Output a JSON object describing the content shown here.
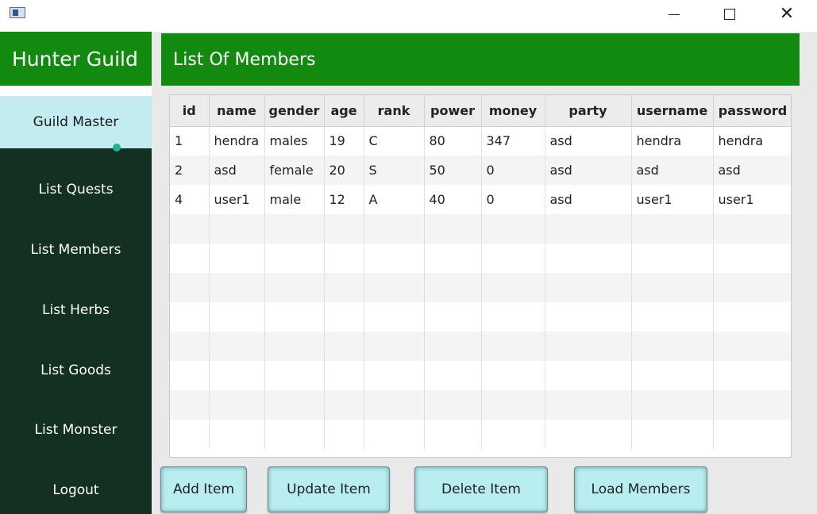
{
  "window": {
    "icons": {
      "minimize": "minimize-icon",
      "maximize": "maximize-icon",
      "close": "close-icon",
      "app": "app-icon"
    }
  },
  "sidebar": {
    "title": "Hunter Guild",
    "items": [
      {
        "label": "Guild Master",
        "active": true
      },
      {
        "label": "List Quests"
      },
      {
        "label": "List Members"
      },
      {
        "label": "List Herbs"
      },
      {
        "label": "List Goods"
      },
      {
        "label": "List Monster"
      },
      {
        "label": "Logout"
      }
    ]
  },
  "main": {
    "title": "List Of Members"
  },
  "table": {
    "columns": [
      "id",
      "name",
      "gender",
      "age",
      "rank",
      "power",
      "money",
      "party",
      "username",
      "password"
    ],
    "rows": [
      [
        "1",
        "hendra",
        "males",
        "19",
        "C",
        "80",
        "347",
        "asd",
        "hendra",
        "hendra"
      ],
      [
        "2",
        "asd",
        "female",
        "20",
        "S",
        "50",
        "0",
        "asd",
        "asd",
        "asd"
      ],
      [
        "4",
        "user1",
        "male",
        "12",
        "A",
        "40",
        "0",
        "asd",
        "user1",
        "user1"
      ]
    ]
  },
  "buttons": {
    "add": "Add Item",
    "update": "Update Item",
    "delete": "Delete Item",
    "load": "Load Members"
  },
  "colors": {
    "header_green": "#118a0f",
    "sidebar_dark": "#133023",
    "active_bg": "#c3ecf0",
    "button_bg": "#b9eef1"
  }
}
